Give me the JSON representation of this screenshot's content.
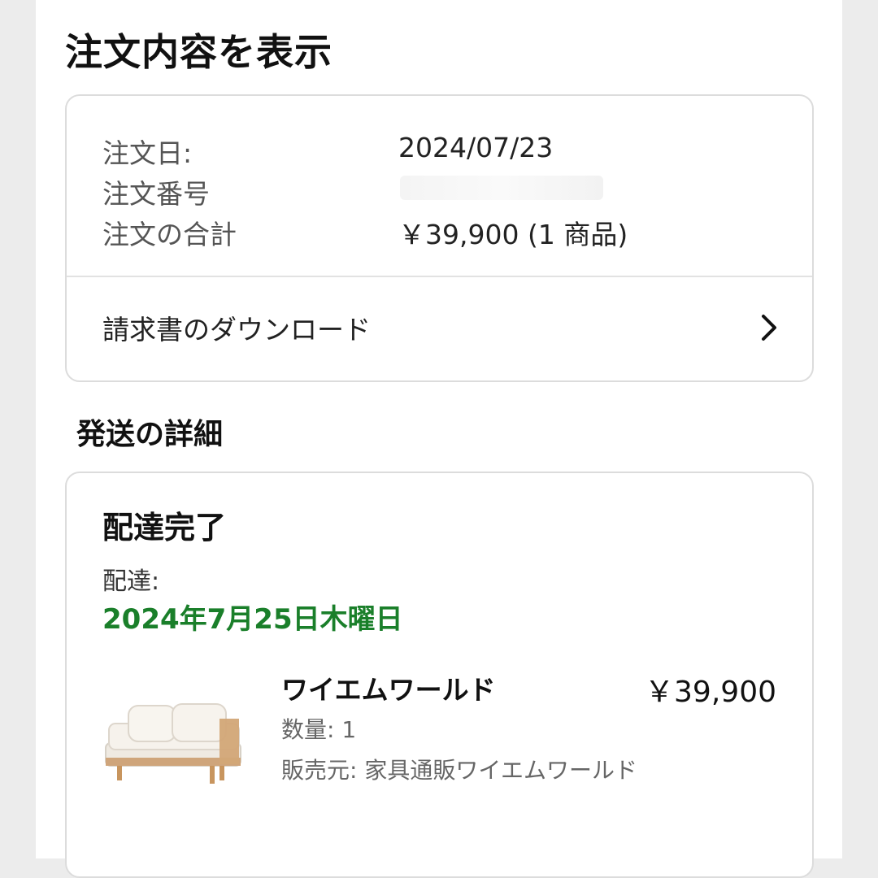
{
  "page_title": "注文内容を表示",
  "order_summary": {
    "order_date_label": "注文日:",
    "order_date_value": "2024/07/23",
    "order_number_label": "注文番号",
    "order_total_label": "注文の合計",
    "order_total_value": "￥39,900 (1 商品)",
    "download_invoice_label": "請求書のダウンロード"
  },
  "shipping_details": {
    "section_title": "発送の詳細",
    "status": "配達完了",
    "delivery_label": "配達:",
    "delivery_date": "2024年7月25日木曜日",
    "delivery_date_color": "#1a7f2a",
    "item": {
      "name": "ワイエムワールド",
      "price": "￥39,900",
      "quantity": "数量: 1",
      "seller": "販売元: 家具通販ワイエムワールド",
      "image_icon": "sofa-image"
    }
  }
}
